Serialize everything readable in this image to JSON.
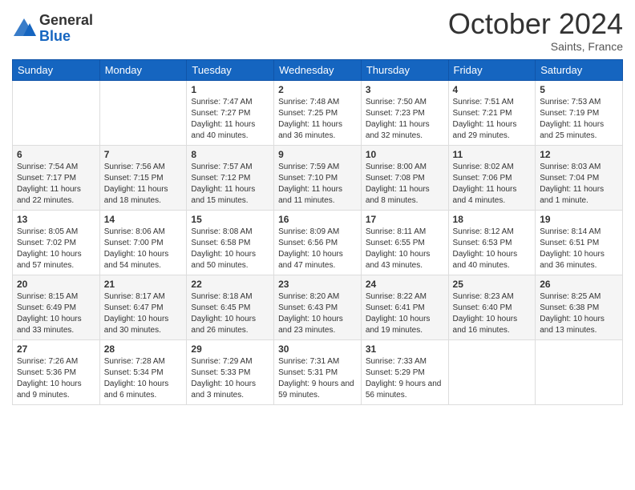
{
  "logo": {
    "general": "General",
    "blue": "Blue"
  },
  "header": {
    "month": "October 2024",
    "location": "Saints, France"
  },
  "days_of_week": [
    "Sunday",
    "Monday",
    "Tuesday",
    "Wednesday",
    "Thursday",
    "Friday",
    "Saturday"
  ],
  "weeks": [
    [
      {
        "day": "",
        "info": ""
      },
      {
        "day": "",
        "info": ""
      },
      {
        "day": "1",
        "info": "Sunrise: 7:47 AM\nSunset: 7:27 PM\nDaylight: 11 hours and 40 minutes."
      },
      {
        "day": "2",
        "info": "Sunrise: 7:48 AM\nSunset: 7:25 PM\nDaylight: 11 hours and 36 minutes."
      },
      {
        "day": "3",
        "info": "Sunrise: 7:50 AM\nSunset: 7:23 PM\nDaylight: 11 hours and 32 minutes."
      },
      {
        "day": "4",
        "info": "Sunrise: 7:51 AM\nSunset: 7:21 PM\nDaylight: 11 hours and 29 minutes."
      },
      {
        "day": "5",
        "info": "Sunrise: 7:53 AM\nSunset: 7:19 PM\nDaylight: 11 hours and 25 minutes."
      }
    ],
    [
      {
        "day": "6",
        "info": "Sunrise: 7:54 AM\nSunset: 7:17 PM\nDaylight: 11 hours and 22 minutes."
      },
      {
        "day": "7",
        "info": "Sunrise: 7:56 AM\nSunset: 7:15 PM\nDaylight: 11 hours and 18 minutes."
      },
      {
        "day": "8",
        "info": "Sunrise: 7:57 AM\nSunset: 7:12 PM\nDaylight: 11 hours and 15 minutes."
      },
      {
        "day": "9",
        "info": "Sunrise: 7:59 AM\nSunset: 7:10 PM\nDaylight: 11 hours and 11 minutes."
      },
      {
        "day": "10",
        "info": "Sunrise: 8:00 AM\nSunset: 7:08 PM\nDaylight: 11 hours and 8 minutes."
      },
      {
        "day": "11",
        "info": "Sunrise: 8:02 AM\nSunset: 7:06 PM\nDaylight: 11 hours and 4 minutes."
      },
      {
        "day": "12",
        "info": "Sunrise: 8:03 AM\nSunset: 7:04 PM\nDaylight: 11 hours and 1 minute."
      }
    ],
    [
      {
        "day": "13",
        "info": "Sunrise: 8:05 AM\nSunset: 7:02 PM\nDaylight: 10 hours and 57 minutes."
      },
      {
        "day": "14",
        "info": "Sunrise: 8:06 AM\nSunset: 7:00 PM\nDaylight: 10 hours and 54 minutes."
      },
      {
        "day": "15",
        "info": "Sunrise: 8:08 AM\nSunset: 6:58 PM\nDaylight: 10 hours and 50 minutes."
      },
      {
        "day": "16",
        "info": "Sunrise: 8:09 AM\nSunset: 6:56 PM\nDaylight: 10 hours and 47 minutes."
      },
      {
        "day": "17",
        "info": "Sunrise: 8:11 AM\nSunset: 6:55 PM\nDaylight: 10 hours and 43 minutes."
      },
      {
        "day": "18",
        "info": "Sunrise: 8:12 AM\nSunset: 6:53 PM\nDaylight: 10 hours and 40 minutes."
      },
      {
        "day": "19",
        "info": "Sunrise: 8:14 AM\nSunset: 6:51 PM\nDaylight: 10 hours and 36 minutes."
      }
    ],
    [
      {
        "day": "20",
        "info": "Sunrise: 8:15 AM\nSunset: 6:49 PM\nDaylight: 10 hours and 33 minutes."
      },
      {
        "day": "21",
        "info": "Sunrise: 8:17 AM\nSunset: 6:47 PM\nDaylight: 10 hours and 30 minutes."
      },
      {
        "day": "22",
        "info": "Sunrise: 8:18 AM\nSunset: 6:45 PM\nDaylight: 10 hours and 26 minutes."
      },
      {
        "day": "23",
        "info": "Sunrise: 8:20 AM\nSunset: 6:43 PM\nDaylight: 10 hours and 23 minutes."
      },
      {
        "day": "24",
        "info": "Sunrise: 8:22 AM\nSunset: 6:41 PM\nDaylight: 10 hours and 19 minutes."
      },
      {
        "day": "25",
        "info": "Sunrise: 8:23 AM\nSunset: 6:40 PM\nDaylight: 10 hours and 16 minutes."
      },
      {
        "day": "26",
        "info": "Sunrise: 8:25 AM\nSunset: 6:38 PM\nDaylight: 10 hours and 13 minutes."
      }
    ],
    [
      {
        "day": "27",
        "info": "Sunrise: 7:26 AM\nSunset: 5:36 PM\nDaylight: 10 hours and 9 minutes."
      },
      {
        "day": "28",
        "info": "Sunrise: 7:28 AM\nSunset: 5:34 PM\nDaylight: 10 hours and 6 minutes."
      },
      {
        "day": "29",
        "info": "Sunrise: 7:29 AM\nSunset: 5:33 PM\nDaylight: 10 hours and 3 minutes."
      },
      {
        "day": "30",
        "info": "Sunrise: 7:31 AM\nSunset: 5:31 PM\nDaylight: 9 hours and 59 minutes."
      },
      {
        "day": "31",
        "info": "Sunrise: 7:33 AM\nSunset: 5:29 PM\nDaylight: 9 hours and 56 minutes."
      },
      {
        "day": "",
        "info": ""
      },
      {
        "day": "",
        "info": ""
      }
    ]
  ]
}
